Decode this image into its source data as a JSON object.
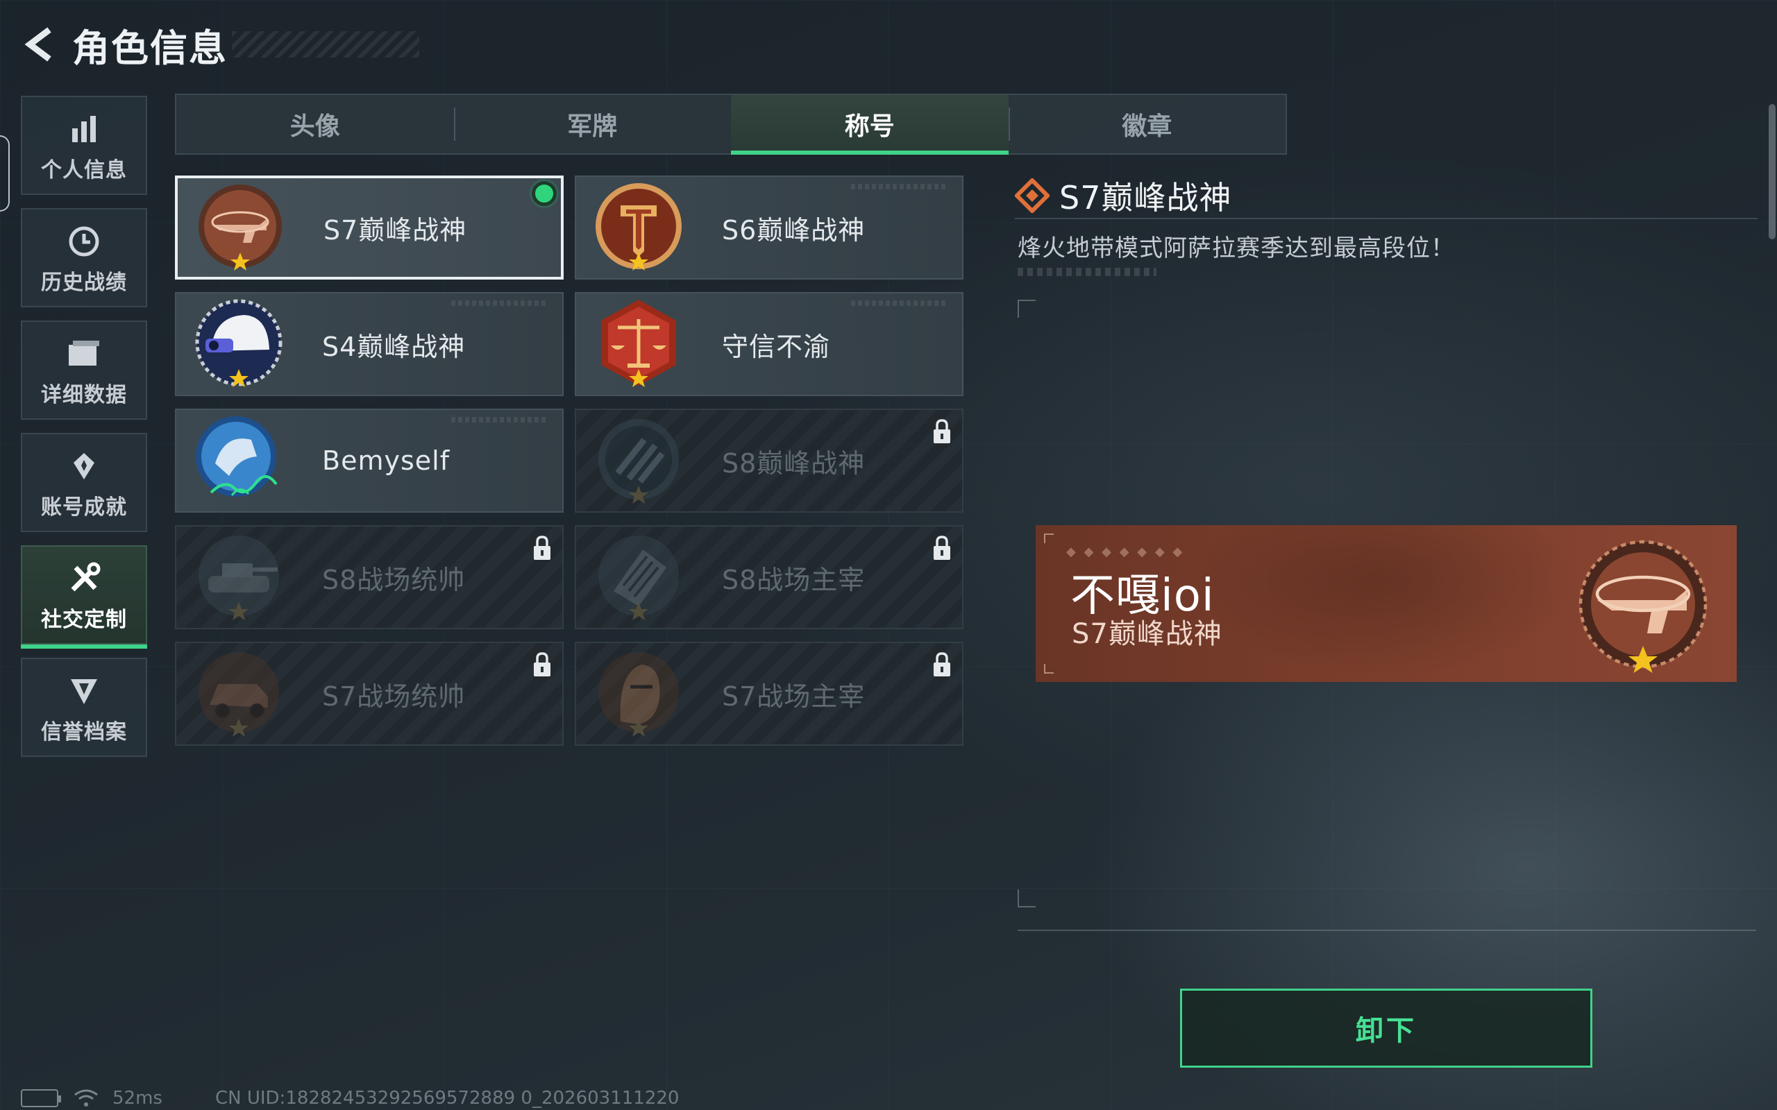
{
  "header": {
    "title": "角色信息"
  },
  "sidebar": {
    "items": [
      {
        "label": "个人信息",
        "icon": "bar-chart-icon",
        "active": false
      },
      {
        "label": "历史战绩",
        "icon": "history-clock-icon",
        "active": false
      },
      {
        "label": "详细数据",
        "icon": "folder-icon",
        "active": false
      },
      {
        "label": "账号成就",
        "icon": "achievement-icon",
        "active": false
      },
      {
        "label": "社交定制",
        "icon": "tools-icon",
        "active": true
      },
      {
        "label": "信誉档案",
        "icon": "reputation-icon",
        "active": false
      }
    ]
  },
  "tabs": [
    {
      "label": "头像",
      "active": false
    },
    {
      "label": "军牌",
      "active": false
    },
    {
      "label": "称号",
      "active": true
    },
    {
      "label": "徽章",
      "active": false
    }
  ],
  "titles": [
    {
      "name": "S7巅峰战神",
      "badge": "gun-bronze-badge",
      "selected": true,
      "locked": false
    },
    {
      "name": "S6巅峰战神",
      "badge": "shield-t-badge",
      "selected": false,
      "locked": false
    },
    {
      "name": "S4巅峰战神",
      "badge": "helmet-badge",
      "selected": false,
      "locked": false
    },
    {
      "name": "守信不渝",
      "badge": "scales-badge",
      "selected": false,
      "locked": false
    },
    {
      "name": "Bemyself",
      "badge": "blue-signature-badge",
      "selected": false,
      "locked": false
    },
    {
      "name": "S8巅峰战神",
      "badge": "stripes-badge",
      "selected": false,
      "locked": true
    },
    {
      "name": "S8战场统帅",
      "badge": "tank-badge",
      "selected": false,
      "locked": true
    },
    {
      "name": "S8战场主宰",
      "badge": "building-badge",
      "selected": false,
      "locked": true
    },
    {
      "name": "S7战场统帅",
      "badge": "vehicle-badge",
      "selected": false,
      "locked": true
    },
    {
      "name": "S7战场主宰",
      "badge": "soldier-face-badge",
      "selected": false,
      "locked": true
    }
  ],
  "detail": {
    "title": "S7巅峰战神",
    "description": "烽火地带模式阿萨拉赛季达到最高段位！",
    "preview_name": "不嘎ioi",
    "preview_title": "S7巅峰战神",
    "unequip_label": "卸下"
  },
  "status": {
    "ping": "52ms",
    "uid": "CN UID:18282453292569572889 0_202603111220"
  },
  "colors": {
    "accent": "#3fd38a",
    "preview_bg": "#7a3d2b",
    "badge_bronze": "#a4583c"
  }
}
